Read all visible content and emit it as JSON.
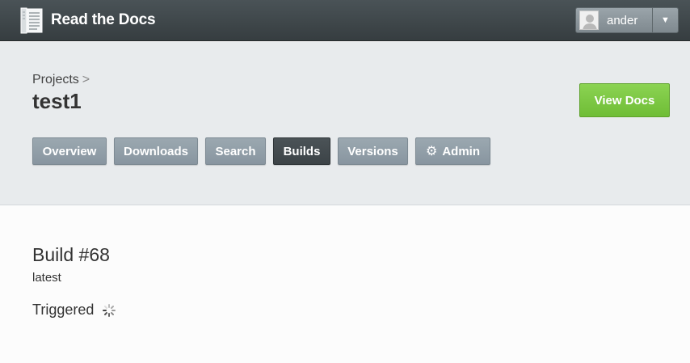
{
  "header": {
    "brand": "Read the Docs",
    "user": {
      "name": "ander"
    }
  },
  "project": {
    "breadcrumb_label": "Projects",
    "breadcrumb_sep": ">",
    "name": "test1",
    "view_docs_label": "View Docs",
    "tabs": [
      {
        "label": "Overview",
        "active": false
      },
      {
        "label": "Downloads",
        "active": false
      },
      {
        "label": "Search",
        "active": false
      },
      {
        "label": "Builds",
        "active": true
      },
      {
        "label": "Versions",
        "active": false
      },
      {
        "label": "Admin",
        "active": false,
        "icon": "gear-icon"
      }
    ]
  },
  "build": {
    "title": "Build #68",
    "version": "latest",
    "status": "Triggered",
    "status_icon": "loading-spinner-icon"
  },
  "colors": {
    "topbar": "#3f474b",
    "band": "#e8ebed",
    "tab": "#909da6",
    "tab_active": "#424a4e",
    "view_docs": "#7cc744"
  }
}
